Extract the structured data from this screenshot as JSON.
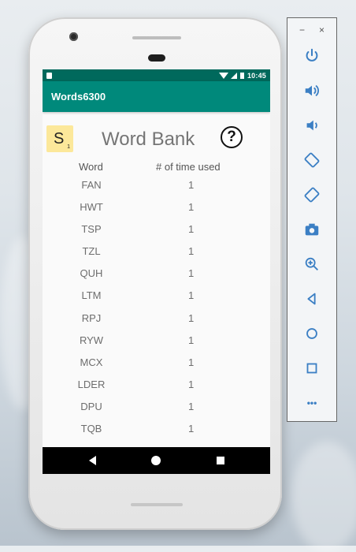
{
  "status_bar": {
    "time": "10:45"
  },
  "app": {
    "title": "Words6300"
  },
  "tile": {
    "letter": "S",
    "points": "1"
  },
  "word_bank": {
    "title": "Word Bank",
    "help_symbol": "?",
    "columns": {
      "word": "Word",
      "times_used": "# of time used"
    },
    "rows": [
      {
        "word": "FAN",
        "count": "1"
      },
      {
        "word": "HWT",
        "count": "1"
      },
      {
        "word": "TSP",
        "count": "1"
      },
      {
        "word": "TZL",
        "count": "1"
      },
      {
        "word": "QUH",
        "count": "1"
      },
      {
        "word": "LTM",
        "count": "1"
      },
      {
        "word": "RPJ",
        "count": "1"
      },
      {
        "word": "RYW",
        "count": "1"
      },
      {
        "word": "MCX",
        "count": "1"
      },
      {
        "word": "LDER",
        "count": "1"
      },
      {
        "word": "DPU",
        "count": "1"
      },
      {
        "word": "TQB",
        "count": "1"
      }
    ]
  },
  "emulator_panel": {
    "minimize": "−",
    "close": "×",
    "more": "•••"
  },
  "colors": {
    "status_bar": "#00695c",
    "app_bar": "#00897b",
    "tile": "#fce89a",
    "icon": "#3b7fc4"
  }
}
